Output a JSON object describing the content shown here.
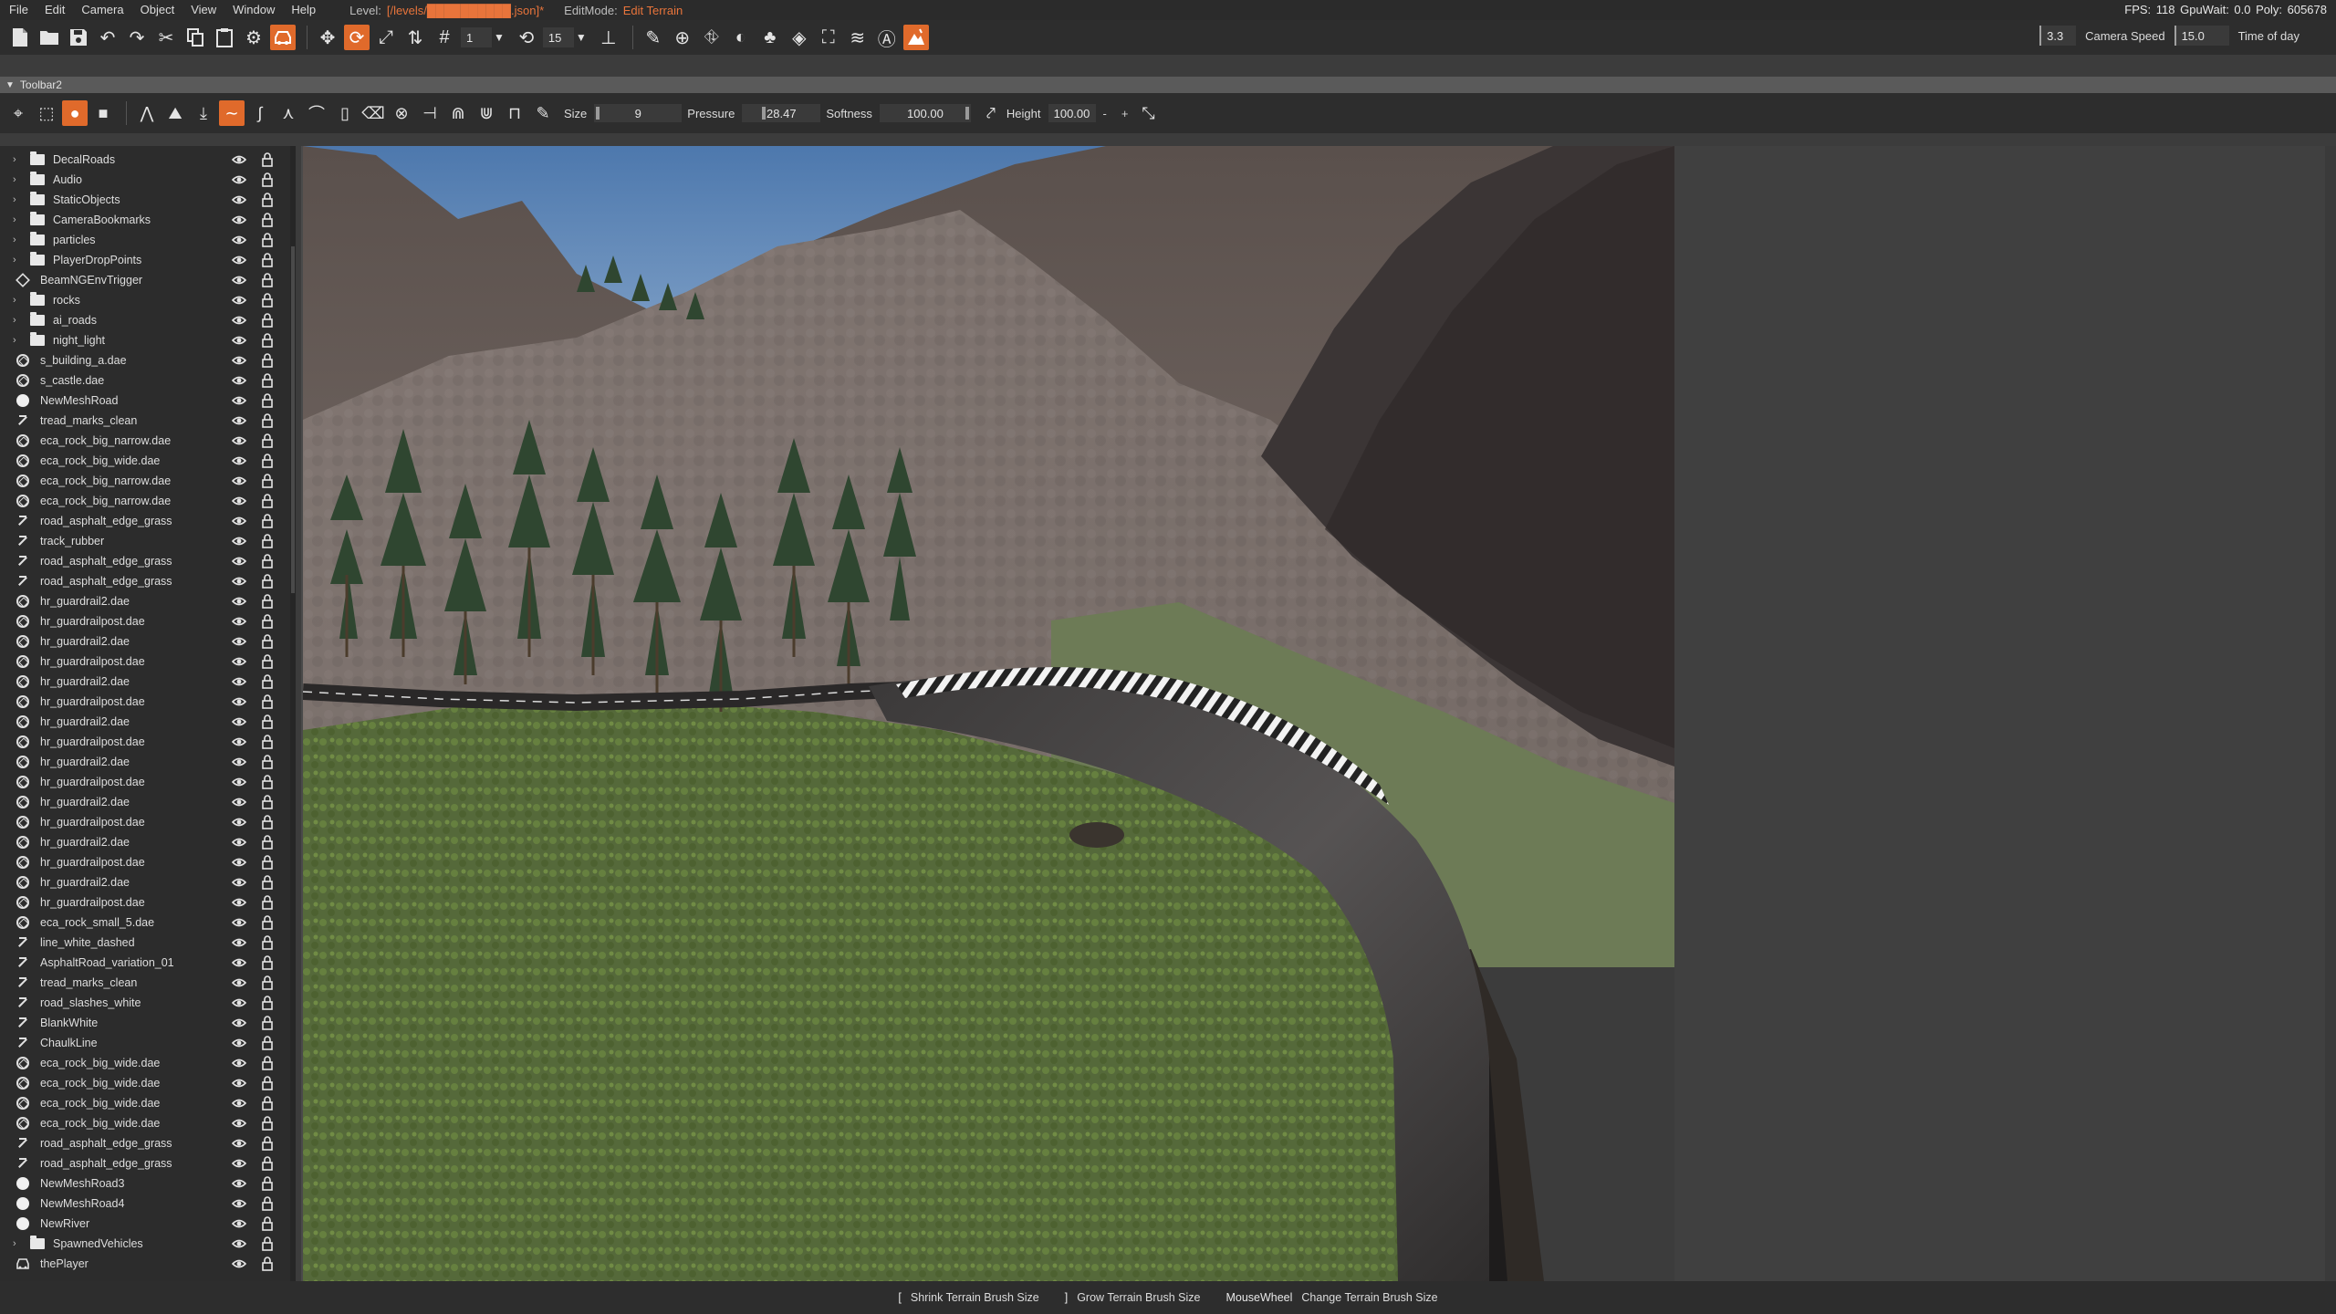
{
  "menu": [
    "File",
    "Edit",
    "Camera",
    "Object",
    "View",
    "Window",
    "Help"
  ],
  "level": {
    "label": "Level:",
    "path": "[/levels/██████████.json]*"
  },
  "editmode": {
    "label": "EditMode:",
    "value": "Edit Terrain"
  },
  "stats": "FPS: 118  GpuWait: 0.0  Poly: 605678",
  "toolbar1": {
    "snap_value": "1",
    "angle_value": "15",
    "camera_speed_value": "3.3",
    "camera_speed_label": "Camera Speed",
    "time_value": "15.0",
    "time_label": "Time of day"
  },
  "toolbar2": {
    "title": "Toolbar2",
    "size_label": "Size",
    "size_value": "9",
    "pressure_label": "Pressure",
    "pressure_value": "28.47",
    "softness_label": "Softness",
    "softness_value": "100.00",
    "height_label": "Height",
    "height_value": "100.00",
    "minus": "-",
    "plus": "+"
  },
  "scene_tree": [
    {
      "label": "DecalRoads",
      "icon": "folder-icon",
      "expandable": true
    },
    {
      "label": "Audio",
      "icon": "folder-icon",
      "expandable": true
    },
    {
      "label": "StaticObjects",
      "icon": "folder-icon",
      "expandable": true
    },
    {
      "label": "CameraBookmarks",
      "icon": "folder-icon",
      "expandable": true
    },
    {
      "label": "particles",
      "icon": "folder-icon",
      "expandable": true
    },
    {
      "label": "PlayerDropPoints",
      "icon": "folder-icon",
      "expandable": true
    },
    {
      "label": "BeamNGEnvTrigger",
      "icon": "trigger-icon",
      "expandable": false
    },
    {
      "label": "rocks",
      "icon": "folder-icon",
      "expandable": true
    },
    {
      "label": "ai_roads",
      "icon": "folder-icon",
      "expandable": true
    },
    {
      "label": "night_light",
      "icon": "folder-icon",
      "expandable": true
    },
    {
      "label": "s_building_a.dae",
      "icon": "object-icon",
      "expandable": false
    },
    {
      "label": "s_castle.dae",
      "icon": "object-icon",
      "expandable": false
    },
    {
      "label": "NewMeshRoad",
      "icon": "circle-icon",
      "expandable": false
    },
    {
      "label": "tread_marks_clean",
      "icon": "road-icon",
      "expandable": false
    },
    {
      "label": "eca_rock_big_narrow.dae",
      "icon": "object-icon",
      "expandable": false
    },
    {
      "label": "eca_rock_big_wide.dae",
      "icon": "object-icon",
      "expandable": false
    },
    {
      "label": "eca_rock_big_narrow.dae",
      "icon": "object-icon",
      "expandable": false
    },
    {
      "label": "eca_rock_big_narrow.dae",
      "icon": "object-icon",
      "expandable": false
    },
    {
      "label": "road_asphalt_edge_grass",
      "icon": "road-icon",
      "expandable": false
    },
    {
      "label": "track_rubber",
      "icon": "road-icon",
      "expandable": false
    },
    {
      "label": "road_asphalt_edge_grass",
      "icon": "road-icon",
      "expandable": false
    },
    {
      "label": "road_asphalt_edge_grass",
      "icon": "road-icon",
      "expandable": false
    },
    {
      "label": "hr_guardrail2.dae",
      "icon": "object-icon",
      "expandable": false
    },
    {
      "label": "hr_guardrailpost.dae",
      "icon": "object-icon",
      "expandable": false
    },
    {
      "label": "hr_guardrail2.dae",
      "icon": "object-icon",
      "expandable": false
    },
    {
      "label": "hr_guardrailpost.dae",
      "icon": "object-icon",
      "expandable": false
    },
    {
      "label": "hr_guardrail2.dae",
      "icon": "object-icon",
      "expandable": false
    },
    {
      "label": "hr_guardrailpost.dae",
      "icon": "object-icon",
      "expandable": false
    },
    {
      "label": "hr_guardrail2.dae",
      "icon": "object-icon",
      "expandable": false
    },
    {
      "label": "hr_guardrailpost.dae",
      "icon": "object-icon",
      "expandable": false
    },
    {
      "label": "hr_guardrail2.dae",
      "icon": "object-icon",
      "expandable": false
    },
    {
      "label": "hr_guardrailpost.dae",
      "icon": "object-icon",
      "expandable": false
    },
    {
      "label": "hr_guardrail2.dae",
      "icon": "object-icon",
      "expandable": false
    },
    {
      "label": "hr_guardrailpost.dae",
      "icon": "object-icon",
      "expandable": false
    },
    {
      "label": "hr_guardrail2.dae",
      "icon": "object-icon",
      "expandable": false
    },
    {
      "label": "hr_guardrailpost.dae",
      "icon": "object-icon",
      "expandable": false
    },
    {
      "label": "hr_guardrail2.dae",
      "icon": "object-icon",
      "expandable": false
    },
    {
      "label": "hr_guardrailpost.dae",
      "icon": "object-icon",
      "expandable": false
    },
    {
      "label": "eca_rock_small_5.dae",
      "icon": "object-icon",
      "expandable": false
    },
    {
      "label": "line_white_dashed",
      "icon": "road-icon",
      "expandable": false
    },
    {
      "label": "AsphaltRoad_variation_01",
      "icon": "road-icon",
      "expandable": false
    },
    {
      "label": "tread_marks_clean",
      "icon": "road-icon",
      "expandable": false
    },
    {
      "label": "road_slashes_white",
      "icon": "road-icon",
      "expandable": false
    },
    {
      "label": "BlankWhite",
      "icon": "road-icon",
      "expandable": false
    },
    {
      "label": "ChaulkLine",
      "icon": "road-icon",
      "expandable": false
    },
    {
      "label": "eca_rock_big_wide.dae",
      "icon": "object-icon",
      "expandable": false
    },
    {
      "label": "eca_rock_big_wide.dae",
      "icon": "object-icon",
      "expandable": false
    },
    {
      "label": "eca_rock_big_wide.dae",
      "icon": "object-icon",
      "expandable": false
    },
    {
      "label": "eca_rock_big_wide.dae",
      "icon": "object-icon",
      "expandable": false
    },
    {
      "label": "road_asphalt_edge_grass",
      "icon": "road-icon",
      "expandable": false
    },
    {
      "label": "road_asphalt_edge_grass",
      "icon": "road-icon",
      "expandable": false
    },
    {
      "label": "NewMeshRoad3",
      "icon": "circle-icon",
      "expandable": false
    },
    {
      "label": "NewMeshRoad4",
      "icon": "circle-icon",
      "expandable": false
    },
    {
      "label": "NewRiver",
      "icon": "circle-icon",
      "expandable": false
    },
    {
      "label": "SpawnedVehicles",
      "icon": "folder-icon",
      "expandable": true
    },
    {
      "label": "thePlayer",
      "icon": "car-icon",
      "expandable": false
    }
  ],
  "status_hints": [
    {
      "key": "[",
      "text": "Shrink Terrain Brush Size"
    },
    {
      "key": "]",
      "text": "Grow Terrain Brush Size"
    },
    {
      "key": "MouseWheel",
      "text": "Change Terrain Brush Size"
    }
  ],
  "colors": {
    "accent": "#e06a2b",
    "level_path": "#e8743b"
  }
}
